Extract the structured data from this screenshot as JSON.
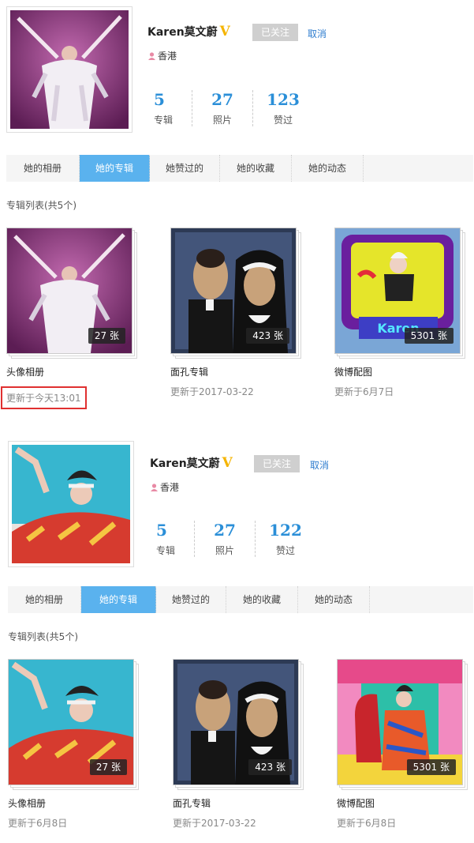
{
  "colors": {
    "accent": "#5ab2ee",
    "number": "#2b8fd8",
    "vbadge": "#f5b400",
    "highlight": "#e03030",
    "link": "#2f7dcf"
  },
  "profiles": [
    {
      "name": "Karen莫文蔚",
      "verified_mark": "V",
      "follow_label": "已关注",
      "cancel_label": "取消",
      "location": "香港",
      "stats": [
        {
          "value": "5",
          "label": "专辑"
        },
        {
          "value": "27",
          "label": "照片"
        },
        {
          "value": "123",
          "label": "赞过"
        }
      ],
      "tabs": [
        "她的相册",
        "她的专辑",
        "她赞过的",
        "她的收藏",
        "她的动态"
      ],
      "active_tab": 1,
      "list_title": "专辑列表(共5个)",
      "albums": [
        {
          "name": "头像相册",
          "date": "更新于今天13:01",
          "count": "27 张",
          "icon": "performer-photo"
        },
        {
          "name": "面孔专辑",
          "date": "更新于2017-03-22",
          "count": "423 张",
          "icon": "cartoon-photo"
        },
        {
          "name": "微博配图",
          "date": "更新于6月7日",
          "count": "5301 张",
          "icon": "tv-photo"
        }
      ]
    },
    {
      "name": "Karen莫文蔚",
      "verified_mark": "V",
      "follow_label": "已关注",
      "cancel_label": "取消",
      "location": "香港",
      "stats": [
        {
          "value": "5",
          "label": "专辑"
        },
        {
          "value": "27",
          "label": "照片"
        },
        {
          "value": "122",
          "label": "赞过"
        }
      ],
      "tabs": [
        "她的相册",
        "她的专辑",
        "她赞过的",
        "她的收藏",
        "她的动态"
      ],
      "active_tab": 1,
      "list_title": "专辑列表(共5个)",
      "albums": [
        {
          "name": "头像相册",
          "date": "更新于6月8日",
          "count": "27 张",
          "icon": "bathtub-photo"
        },
        {
          "name": "面孔专辑",
          "date": "更新于2017-03-22",
          "count": "423 张",
          "icon": "cartoon-photo"
        },
        {
          "name": "微博配图",
          "date": "更新于6月8日",
          "count": "5301 张",
          "icon": "chair-photo"
        }
      ]
    }
  ]
}
